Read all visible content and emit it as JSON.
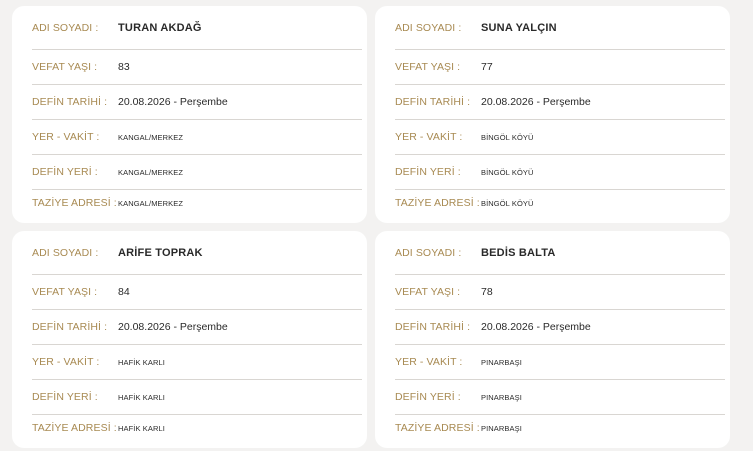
{
  "labels": {
    "name": "ADI SOYADI :",
    "age": "VEFAT YAŞI :",
    "burial_date": "DEFİN TARİHİ :",
    "place_time": "YER - VAKİT :",
    "burial_place": "DEFİN YERİ :",
    "condolence_address": "TAZİYE ADRESİ :"
  },
  "cards": [
    {
      "name": "TURAN AKDAĞ",
      "age": "83",
      "burial_date": "20.08.2026 - Perşembe",
      "place_time": "KANGAL/MERKEZ",
      "burial_place": "KANGAL/MERKEZ",
      "condolence_address": "KANGAL/MERKEZ"
    },
    {
      "name": "SUNA YALÇIN",
      "age": "77",
      "burial_date": "20.08.2026 - Perşembe",
      "place_time": "BİNGÖL KÖYÜ",
      "burial_place": "BİNGÖL KÖYÜ",
      "condolence_address": "BİNGÖL KÖYÜ"
    },
    {
      "name": "ARİFE TOPRAK",
      "age": "84",
      "burial_date": "20.08.2026 - Perşembe",
      "place_time": "HAFİK KARLI",
      "burial_place": "HAFİK KARLI",
      "condolence_address": "HAFİK KARLI"
    },
    {
      "name": "BEDİS BALTA",
      "age": "78",
      "burial_date": "20.08.2026 - Perşembe",
      "place_time": "PINARBAŞI",
      "burial_place": "PINARBAŞI",
      "condolence_address": "PINARBAŞI"
    }
  ],
  "colors": {
    "label": "#a88a52",
    "value": "#2a2a2a",
    "divider": "#d9d6d2",
    "card": "#ffffff",
    "background": "#f3f2f1"
  }
}
